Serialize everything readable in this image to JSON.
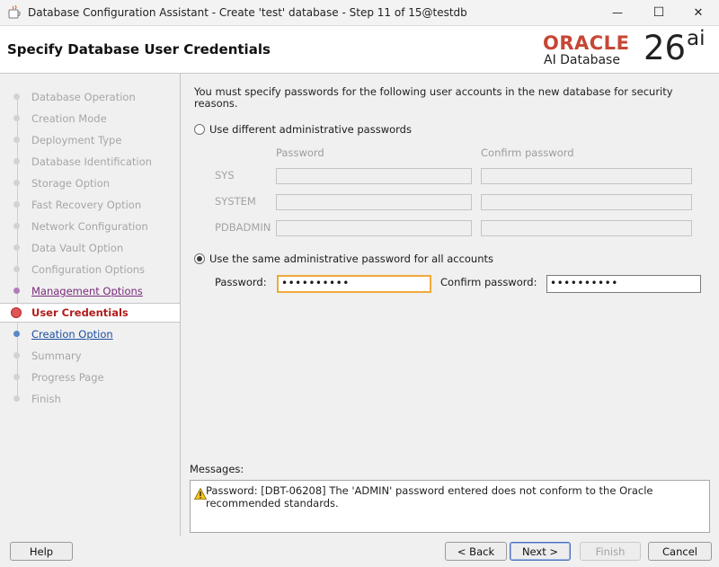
{
  "window": {
    "title": "Database Configuration Assistant - Create 'test' database - Step 11 of 15@testdb",
    "minimize_glyph": "—",
    "maximize_glyph": "☐",
    "close_glyph": "✕"
  },
  "header": {
    "title": "Specify Database User Credentials",
    "logo_oracle": "ORACLE",
    "logo_product": "AI Database",
    "logo_version": "26",
    "logo_suffix": "ai"
  },
  "sidebar": {
    "items": [
      {
        "label": "Database Operation",
        "state": "disabled"
      },
      {
        "label": "Creation Mode",
        "state": "disabled"
      },
      {
        "label": "Deployment Type",
        "state": "disabled"
      },
      {
        "label": "Database Identification",
        "state": "disabled"
      },
      {
        "label": "Storage Option",
        "state": "disabled"
      },
      {
        "label": "Fast Recovery Option",
        "state": "disabled"
      },
      {
        "label": "Network Configuration",
        "state": "disabled"
      },
      {
        "label": "Data Vault Option",
        "state": "disabled"
      },
      {
        "label": "Configuration Options",
        "state": "disabled"
      },
      {
        "label": "Management Options",
        "state": "visited"
      },
      {
        "label": "User Credentials",
        "state": "current"
      },
      {
        "label": "Creation Option",
        "state": "next"
      },
      {
        "label": "Summary",
        "state": "disabled"
      },
      {
        "label": "Progress Page",
        "state": "disabled"
      },
      {
        "label": "Finish",
        "state": "disabled"
      }
    ]
  },
  "content": {
    "intro": "You must specify passwords for the following user accounts in the new database for security reasons.",
    "option_different": "Use different administrative passwords",
    "col_password": "Password",
    "col_confirm": "Confirm password",
    "accounts": [
      "SYS",
      "SYSTEM",
      "PDBADMIN"
    ],
    "option_same": "Use the same administrative password for all accounts",
    "password_label": "Password:",
    "password_value": "••••••••••",
    "confirm_label": "Confirm password:",
    "confirm_value": "••••••••••",
    "messages_label": "Messages:",
    "message_text": "Password: [DBT-06208] The 'ADMIN' password entered does not conform to the Oracle recommended standards."
  },
  "buttons": {
    "help": "Help",
    "back": "< Back",
    "next": "Next >",
    "finish": "Finish",
    "cancel": "Cancel"
  },
  "colors": {
    "oracle_red": "#c74634",
    "current_step": "#b21c1c",
    "focus_border": "#f0a93b",
    "link_blue": "#1d4fa0",
    "visited_purple": "#7a2a7a"
  }
}
